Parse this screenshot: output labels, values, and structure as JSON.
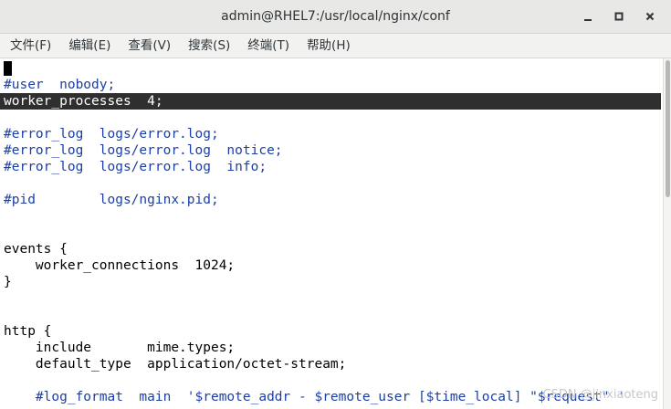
{
  "window": {
    "title": "admin@RHEL7:/usr/local/nginx/conf",
    "controls": [
      "minimize-icon",
      "maximize-icon",
      "close-icon"
    ]
  },
  "menu": {
    "file": "文件(F)",
    "edit": "编辑(E)",
    "view": "查看(V)",
    "search": "搜索(S)",
    "terminal": "终端(T)",
    "help": "帮助(H)"
  },
  "terminal": {
    "lines": [
      "",
      "#user  nobody;",
      "worker_processes  4;",
      "",
      "#error_log  logs/error.log;",
      "#error_log  logs/error.log  notice;",
      "#error_log  logs/error.log  info;",
      "",
      "#pid        logs/nginx.pid;",
      "",
      "",
      "events {",
      "    worker_connections  1024;",
      "}",
      "",
      "",
      "http {",
      "    include       mime.types;",
      "    default_type  application/octet-stream;",
      "",
      "    #log_format  main  '$remote_addr - $remote_user [$time_local] \"$request\" '"
    ]
  },
  "watermark": "CSDN @jinxiaoteng",
  "colors": {
    "comment": "#1c3fa6",
    "highlight_bg": "#2f2f2f",
    "highlight_fg": "#ffffff"
  }
}
